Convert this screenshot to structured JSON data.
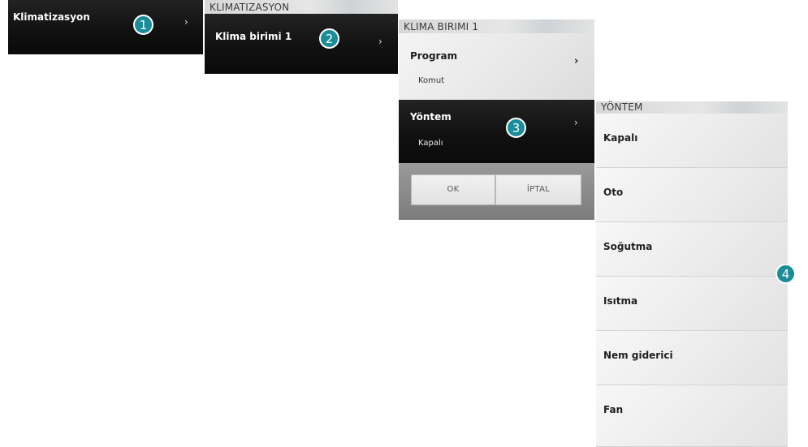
{
  "panel1": {
    "item": "Klimatizasyon",
    "badge": "1",
    "chevron": "›"
  },
  "panel2": {
    "header": "KLIMATIZASYON",
    "item": "Klima birimi 1",
    "badge": "2",
    "chevron": "›"
  },
  "panel3": {
    "header": "KLIMA BIRIMI 1",
    "program": {
      "label": "Program",
      "value": "Komut",
      "chevron": "›"
    },
    "mode": {
      "label": "Yöntem",
      "value": "Kapalı",
      "chevron": "›"
    },
    "badge": "3",
    "ok_label": "OK",
    "cancel_label": "İPTAL"
  },
  "panel4": {
    "header": "YÖNTEM",
    "badge": "4",
    "options": [
      "Kapalı",
      "Oto",
      "Soğutma",
      "Isıtma",
      "Nem giderici",
      "Fan"
    ]
  }
}
